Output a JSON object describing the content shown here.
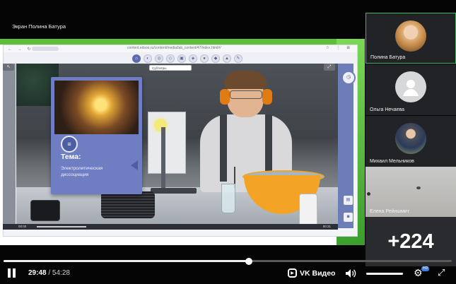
{
  "screen_share": {
    "label": "Экран Полина Батура"
  },
  "browser": {
    "tab_chip": "content.edsoo.ru",
    "url": "content.edsoo.ru/content/media/lab_content/47/index.html#/"
  },
  "scene": {
    "clip_label": "Субтитры",
    "topic_title": "Тема:",
    "topic_subtitle": "Электролитическая диссоциация",
    "player_time": "00:00",
    "player_end": "00:31"
  },
  "participants": [
    {
      "name": "Полина Батура",
      "active": true
    },
    {
      "name": "Ольга Нечаева",
      "active": false
    },
    {
      "name": "Михаил Мельников",
      "active": false
    },
    {
      "name": "Елена Рейншмит",
      "active": false
    }
  ],
  "more_participants": "+224",
  "player": {
    "progress": 0.548,
    "current_time": "29:48",
    "total_time": "54:28",
    "brand": "VK Видео",
    "quality_badge": "HD",
    "volume": 1.0
  },
  "colors": {
    "accent_green": "#41b861",
    "slide_card": "#6f7ec2"
  }
}
